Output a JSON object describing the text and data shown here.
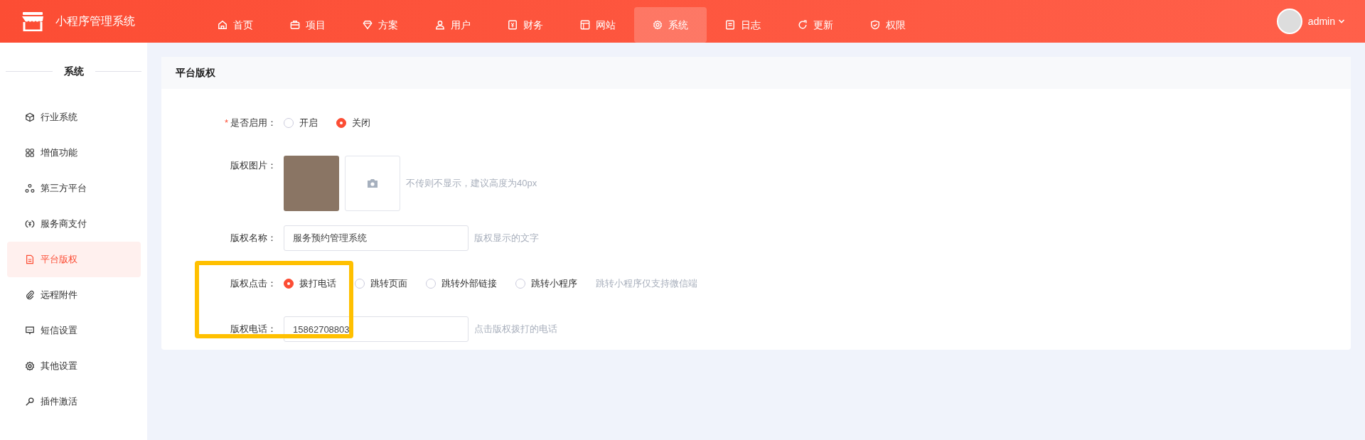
{
  "app": {
    "title": "小程序管理系统"
  },
  "nav": [
    {
      "label": "首页",
      "selected": false
    },
    {
      "label": "项目",
      "selected": false
    },
    {
      "label": "方案",
      "selected": false
    },
    {
      "label": "用户",
      "selected": false
    },
    {
      "label": "财务",
      "selected": false
    },
    {
      "label": "网站",
      "selected": false
    },
    {
      "label": "系统",
      "selected": true
    },
    {
      "label": "日志",
      "selected": false
    },
    {
      "label": "更新",
      "selected": false
    },
    {
      "label": "权限",
      "selected": false
    }
  ],
  "user": {
    "name": "admin"
  },
  "sidebar": {
    "title": "系统",
    "items": [
      {
        "label": "行业系统",
        "selected": false
      },
      {
        "label": "增值功能",
        "selected": false
      },
      {
        "label": "第三方平台",
        "selected": false
      },
      {
        "label": "服务商支付",
        "selected": false
      },
      {
        "label": "平台版权",
        "selected": true
      },
      {
        "label": "远程附件",
        "selected": false
      },
      {
        "label": "短信设置",
        "selected": false
      },
      {
        "label": "其他设置",
        "selected": false
      },
      {
        "label": "插件激活",
        "selected": false
      }
    ]
  },
  "panel": {
    "title": "平台版权",
    "fields": [
      {
        "kind": "radio",
        "required_mark": "*",
        "label": "是否启用：",
        "options": [
          {
            "label": "开启",
            "selected": false
          },
          {
            "label": "关闭",
            "selected": true
          }
        ]
      },
      {
        "kind": "image",
        "label": "版权图片：",
        "hint": "不传则不显示，建议高度为40px"
      },
      {
        "kind": "text",
        "label": "版权名称：",
        "value": "服务预约管理系统",
        "hint": "版权显示的文字"
      },
      {
        "kind": "radio",
        "label": "版权点击：",
        "options": [
          {
            "label": "拨打电话",
            "selected": true
          },
          {
            "label": "跳转页面",
            "selected": false
          },
          {
            "label": "跳转外部链接",
            "selected": false
          },
          {
            "label": "跳转小程序",
            "selected": false
          }
        ],
        "hint": "跳转小程序仅支持微信端"
      },
      {
        "kind": "text",
        "label": "版权电话：",
        "value": "15862708803",
        "hint": "点击版权拨打的电话"
      }
    ]
  },
  "annotation": {
    "kind": "highlight-box",
    "color": "#ffc000"
  }
}
